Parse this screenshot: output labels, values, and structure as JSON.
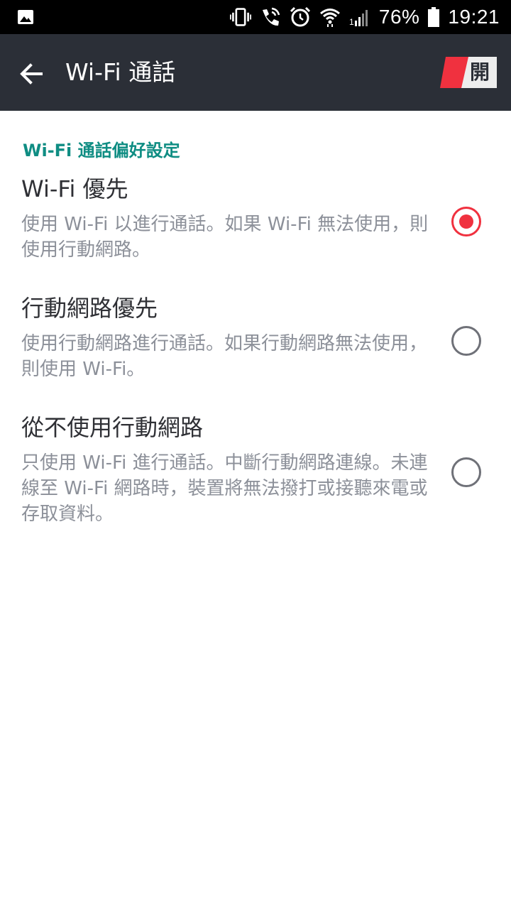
{
  "status_bar": {
    "icons": [
      "image-icon",
      "vibrate-icon",
      "wifi-calling-icon",
      "alarm-icon",
      "wifi-icon",
      "signal-icon",
      "battery-icon"
    ],
    "battery": "76%",
    "time": "19:21"
  },
  "app_bar": {
    "back_icon": "arrow-left-icon",
    "title": "Wi-Fi 通話",
    "toggle_label": "開",
    "toggle_state": "on",
    "toggle_color": "#f0313f"
  },
  "preferences": {
    "section_title": "Wi-Fi 通話偏好設定",
    "options": [
      {
        "title": "Wi-Fi 優先",
        "description": "使用 Wi-Fi 以進行通話。如果 Wi-Fi 無法使用，則使用行動網路。",
        "selected": true
      },
      {
        "title": "行動網路優先",
        "description": "使用行動網路進行通話。如果行動網路無法使用，則使用 Wi-Fi。",
        "selected": false
      },
      {
        "title": "從不使用行動網路",
        "description": "只使用 Wi-Fi 進行通話。中斷行動網路連線。未連線至 Wi-Fi 網路時，裝置將無法撥打或接聽來電或存取資料。",
        "selected": false
      }
    ]
  },
  "colors": {
    "accent_teal": "#0f8d83",
    "accent_red": "#f0313f",
    "app_bar_bg": "#2b2f37"
  }
}
